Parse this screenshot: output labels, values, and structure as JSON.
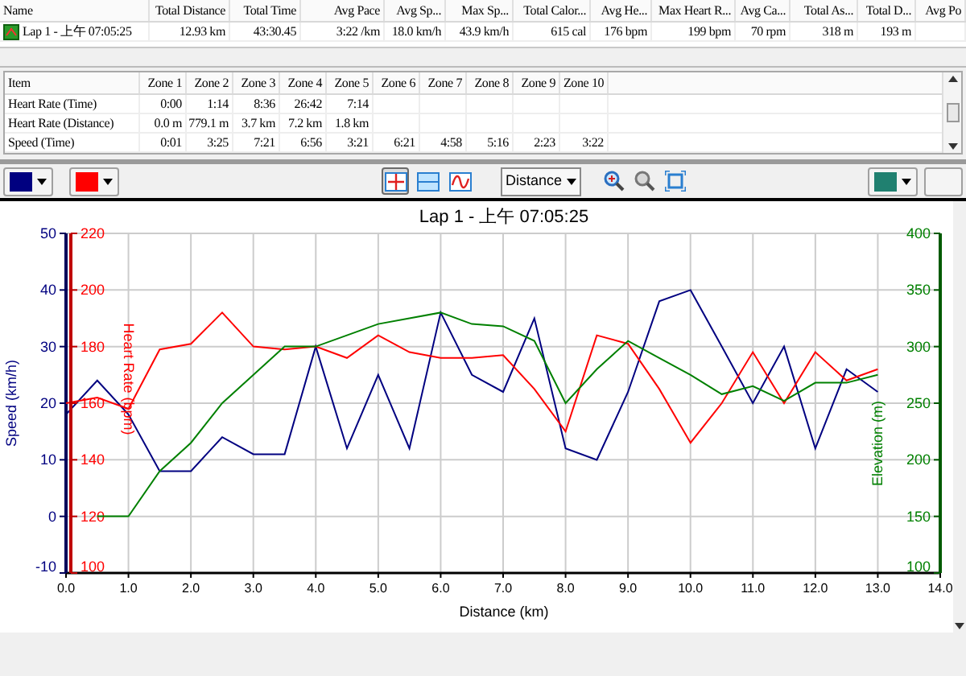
{
  "laps_table": {
    "columns": [
      "Name",
      "Total Distance",
      "Total Time",
      "Avg Pace",
      "Avg Sp...",
      "Max Sp...",
      "Total Calor...",
      "Avg He...",
      "Max Heart R...",
      "Avg Ca...",
      "Total As...",
      "Total D...",
      "Avg Po"
    ],
    "rows": [
      {
        "cells": [
          "Lap 1 - 上午 07:05:25",
          "12.93 km",
          "43:30.45",
          "3:22 /km",
          "18.0 km/h",
          "43.9 km/h",
          "615 cal",
          "176 bpm",
          "199 bpm",
          "70 rpm",
          "318 m",
          "193 m"
        ]
      }
    ]
  },
  "zones_table": {
    "columns": [
      "Item",
      "Zone 1",
      "Zone 2",
      "Zone 3",
      "Zone 4",
      "Zone 5",
      "Zone 6",
      "Zone 7",
      "Zone 8",
      "Zone 9",
      "Zone 10"
    ],
    "rows": [
      {
        "cells": [
          "Heart Rate (Time)",
          "0:00",
          "1:14",
          "8:36",
          "26:42",
          "7:14"
        ]
      },
      {
        "cells": [
          "Heart Rate (Distance)",
          "0.0 m",
          "779.1 m",
          "3.7 km",
          "7.2 km",
          "1.8 km"
        ]
      },
      {
        "cells": [
          "Speed (Time)",
          "0:01",
          "3:25",
          "7:21",
          "6:56",
          "3:21",
          "6:21",
          "4:58",
          "5:16",
          "2:23",
          "3:22"
        ]
      }
    ]
  },
  "toolbar": {
    "left_colors": [
      {
        "color": "#000080"
      },
      {
        "color": "#ff0000"
      }
    ],
    "view_buttons": [
      {
        "kind": "markers",
        "selected": true
      },
      {
        "kind": "bands",
        "selected": false
      },
      {
        "kind": "curve",
        "selected": false
      }
    ],
    "axis_dropdown": {
      "value": "Distance"
    },
    "right_colors": [
      {
        "color": "#208070"
      }
    ]
  },
  "charts": [
    {
      "chart_data": {
        "type": "line",
        "title": "Lap 1 - 上午 07:05:25",
        "xlabel": "Distance (km)",
        "ylabel": "Speed (km/h)",
        "grid": true,
        "xlim": [
          0,
          14
        ],
        "ylim": [
          -10,
          50
        ],
        "xticks": [
          {
            "value": 0,
            "label": "0.0"
          },
          {
            "value": 1,
            "label": "1.0"
          },
          {
            "value": 2,
            "label": "2.0"
          },
          {
            "value": 3,
            "label": "3.0"
          },
          {
            "value": 4,
            "label": "4.0"
          },
          {
            "value": 5,
            "label": "5.0"
          },
          {
            "value": 6,
            "label": "6.0"
          },
          {
            "value": 7,
            "label": "7.0"
          },
          {
            "value": 8,
            "label": "8.0"
          },
          {
            "value": 9,
            "label": "9.0"
          },
          {
            "value": 10,
            "label": "10.0"
          },
          {
            "value": 11,
            "label": "11.0"
          },
          {
            "value": 12,
            "label": "12.0"
          },
          {
            "value": 13,
            "label": "13.0"
          },
          {
            "value": 14,
            "label": "14.0"
          }
        ],
        "yticks": [
          50,
          40,
          30,
          20,
          10,
          0,
          -10
        ],
        "x": [
          0,
          0.5,
          1,
          1.5,
          2,
          2.5,
          3,
          3.5,
          4,
          4.5,
          5,
          5.5,
          6,
          6.5,
          7,
          7.5,
          8,
          8.5,
          9,
          9.5,
          10,
          10.5,
          11,
          11.5,
          12,
          12.5,
          13
        ],
        "series": [
          {
            "color": "#000080",
            "values": [
              18,
              24,
              18,
              8,
              8,
              14,
              11,
              11,
              30,
              12,
              25,
              12,
              36,
              25,
              22,
              35,
              12,
              10,
              22,
              38,
              40,
              30,
              20,
              30,
              12,
              26,
              22
            ]
          }
        ]
      }
    },
    {
      "chart_data": {
        "type": "line",
        "ylabel": "Heart Rate (bpm)",
        "xlim": [
          0,
          14
        ],
        "ylim": [
          100,
          220
        ],
        "yticks": [
          220,
          200,
          180,
          160,
          140,
          120,
          100
        ],
        "x": [
          0,
          0.5,
          1,
          1.5,
          2,
          2.5,
          3,
          3.5,
          4,
          4.5,
          5,
          5.5,
          6,
          6.5,
          7,
          7.5,
          8,
          8.5,
          9,
          9.5,
          10,
          10.5,
          11,
          11.5,
          12,
          12.5,
          13
        ],
        "series": [
          {
            "color": "#ff0000",
            "values": [
              160,
              162,
              158,
              179,
              181,
              192,
              180,
              179,
              180,
              176,
              184,
              178,
              176,
              176,
              177,
              165,
              150,
              184,
              181,
              165,
              146,
              160,
              178,
              160,
              178,
              168,
              172
            ]
          }
        ]
      }
    },
    {
      "chart_data": {
        "type": "line",
        "ylabel": "Elevation (m)",
        "xlim": [
          0,
          14
        ],
        "ylim": [
          100,
          400
        ],
        "yticks": [
          400,
          350,
          300,
          250,
          200,
          150,
          100
        ],
        "x": [
          0.5,
          1,
          1.5,
          2,
          2.5,
          3,
          3.5,
          4,
          4.5,
          5,
          5.5,
          6,
          6.5,
          7,
          7.5,
          8,
          8.5,
          9,
          9.5,
          10,
          10.5,
          11,
          11.5,
          12,
          12.5,
          13
        ],
        "series": [
          {
            "color": "#008000",
            "values": [
              150,
              150,
              190,
              215,
              250,
              275,
              300,
              300,
              310,
              320,
              325,
              330,
              320,
              318,
              305,
              250,
              280,
              305,
              290,
              275,
              258,
              265,
              252,
              268,
              268,
              275
            ]
          }
        ]
      }
    }
  ]
}
